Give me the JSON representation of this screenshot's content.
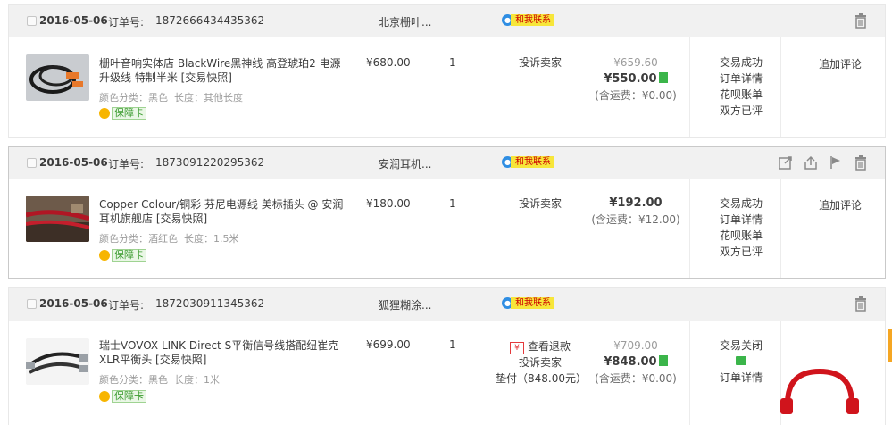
{
  "contact_label": "和我联系",
  "orders": [
    {
      "date": "2016-05-06",
      "order_no_label": "订单号:",
      "order_no": "1872666434435362",
      "shop": "北京栅叶...",
      "product_title": "栅叶音响实体店 BlackWire黑神线 高登琥珀2 电源升级线 特制半米 [交易快照]",
      "attr_color_label": "颜色分类：",
      "attr_color": "黑色",
      "attr_len_label": "长度：",
      "attr_len": "其他长度",
      "guarantee": "保障卡",
      "unit_price": "¥680.00",
      "qty": "1",
      "action": "投诉卖家",
      "orig_total": "¥659.60",
      "total": "¥550.00",
      "shipping": "(含运费：¥0.00)",
      "status": [
        "交易成功",
        "订单详情",
        "花呗账单",
        "双方已评"
      ],
      "op": "追加评论"
    },
    {
      "date": "2016-05-06",
      "order_no_label": "订单号:",
      "order_no": "1873091220295362",
      "shop": "安润耳机...",
      "product_title": "Copper Colour/铜彩 芬尼电源线 美标插头 @ 安润耳机旗舰店 [交易快照]",
      "attr_color_label": "颜色分类：",
      "attr_color": "酒红色",
      "attr_len_label": "长度：",
      "attr_len": "1.5米",
      "guarantee": "保障卡",
      "unit_price": "¥180.00",
      "qty": "1",
      "action": "投诉卖家",
      "total": "¥192.00",
      "shipping": "(含运费：¥12.00)",
      "status": [
        "交易成功",
        "订单详情",
        "花呗账单",
        "双方已评"
      ],
      "op": "追加评论"
    },
    {
      "date": "2016-05-06",
      "order_no_label": "订单号:",
      "order_no": "1872030911345362",
      "shop": "狐狸糊涂...",
      "product_title": "瑞士VOVOX LINK Direct S平衡信号线搭配纽崔克XLR平衡头 [交易快照]",
      "attr_color_label": "颜色分类：",
      "attr_color": "黑色",
      "attr_len_label": "长度：",
      "attr_len": "1米",
      "guarantee": "保障卡",
      "unit_price": "¥699.00",
      "qty": "1",
      "refund": "查看退款",
      "action": "投诉卖家",
      "advance": "垫付（848.00元）",
      "orig_total": "¥709.00",
      "total": "¥848.00",
      "shipping": "(含运费：¥0.00)",
      "status": [
        "交易关闭",
        "订单详情"
      ]
    }
  ]
}
